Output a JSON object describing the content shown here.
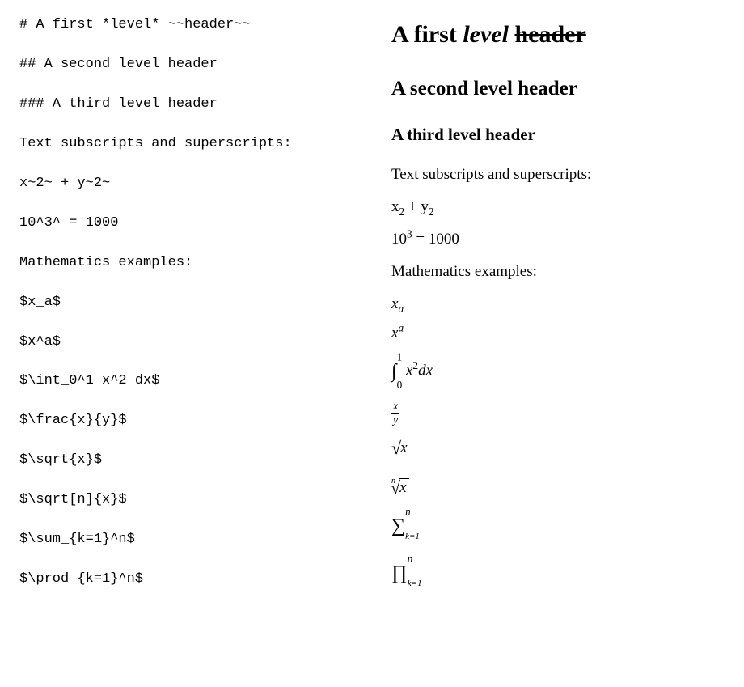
{
  "source": {
    "lines": [
      "# A first *level* ~~header~~",
      "## A second level header",
      "### A third level header",
      "Text subscripts and superscripts:",
      "x~2~ + y~2~",
      "10^3^ = 1000",
      "Mathematics examples:",
      "$x_a$",
      "$x^a$",
      "$\\int_0^1 x^2 dx$",
      "$\\frac{x}{y}$",
      "$\\sqrt{x}$",
      "$\\sqrt[n]{x}$",
      "$\\sum_{k=1}^n$",
      "$\\prod_{k=1}^n$"
    ]
  },
  "rendered": {
    "h1": {
      "pre": "A first ",
      "ital": "level",
      "mid": " ",
      "strike": "header"
    },
    "h2": "A second level header",
    "h3": "A third level header",
    "p_subsup": "Text subscripts and superscripts:",
    "eq_subs": {
      "a": "x",
      "asub": "2",
      "plus": " + ",
      "b": "y",
      "bsub": "2"
    },
    "eq_sup": {
      "base": "10",
      "sup": "3",
      "eq": " = 1000"
    },
    "p_math": "Mathematics examples:",
    "m_xsub": {
      "x": "x",
      "a": "a"
    },
    "m_xsup": {
      "x": "x",
      "a": "a"
    },
    "m_int": {
      "lo": "0",
      "hi": "1",
      "body1": " x",
      "body_sup": "2",
      "body2": "dx"
    },
    "m_frac": {
      "num": "x",
      "den": "y"
    },
    "m_sqrt": {
      "rad": "x"
    },
    "m_sqrtn": {
      "root": "n",
      "rad": "x"
    },
    "m_sum": {
      "lo": "k=1",
      "hi": "n"
    },
    "m_prod": {
      "lo": "k=1",
      "hi": "n"
    }
  }
}
